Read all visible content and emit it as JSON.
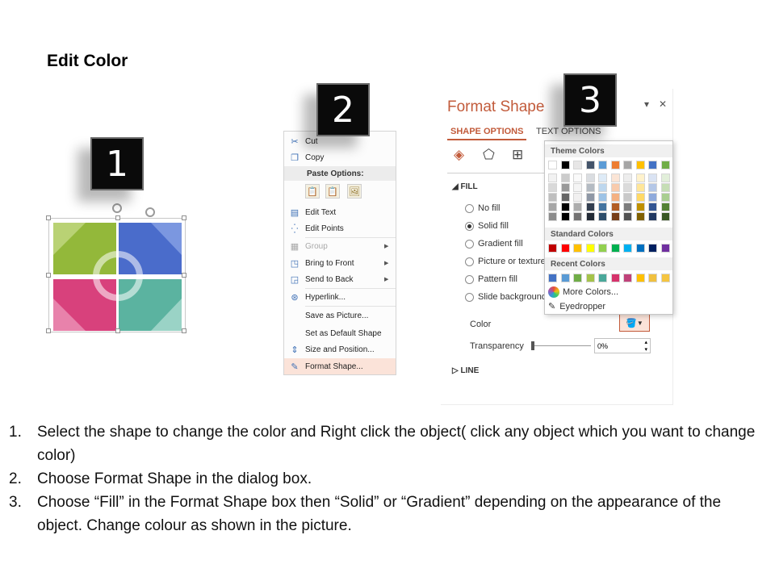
{
  "title": "Edit Color",
  "badges": [
    "1",
    "2",
    "3"
  ],
  "context_menu": {
    "items": [
      {
        "icon": "scissors-icon",
        "glyph": "✂",
        "label": "Cut"
      },
      {
        "icon": "copy-icon",
        "glyph": "❐",
        "label": "Copy"
      }
    ],
    "paste_header": "Paste Options:",
    "items2": [
      {
        "icon": "edit-text-icon",
        "glyph": "▤",
        "label": "Edit Text"
      },
      {
        "icon": "edit-points-icon",
        "glyph": "⁛",
        "label": "Edit Points"
      },
      {
        "icon": "group-icon",
        "glyph": "▦",
        "label": "Group",
        "disabled": true,
        "submenu": true
      },
      {
        "icon": "bring-front-icon",
        "glyph": "◳",
        "label": "Bring to Front",
        "submenu": true
      },
      {
        "icon": "send-back-icon",
        "glyph": "◲",
        "label": "Send to Back",
        "submenu": true
      },
      {
        "icon": "hyperlink-icon",
        "glyph": "⊛",
        "label": "Hyperlink..."
      },
      {
        "icon": "",
        "glyph": "",
        "label": "Save as Picture..."
      },
      {
        "icon": "",
        "glyph": "",
        "label": "Set as Default Shape"
      },
      {
        "icon": "size-position-icon",
        "glyph": "⇕",
        "label": "Size and Position..."
      },
      {
        "icon": "format-shape-icon",
        "glyph": "✎",
        "label": "Format Shape..."
      }
    ]
  },
  "format_pane": {
    "title": "Format Shape",
    "tab_shape": "SHAPE OPTIONS",
    "tab_text": "TEXT OPTIONS",
    "fill_section": "FILL",
    "fill_options": [
      "No fill",
      "Solid fill",
      "Gradient fill",
      "Picture or texture fill",
      "Pattern fill",
      "Slide background fill"
    ],
    "selected_fill": "Solid fill",
    "color_label": "Color",
    "transparency_label": "Transparency",
    "transparency_value": "0%",
    "line_section": "LINE"
  },
  "palette": {
    "theme_header": "Theme Colors",
    "standard_header": "Standard Colors",
    "recent_header": "Recent Colors",
    "more_colors": "More Colors...",
    "eyedropper": "Eyedropper",
    "theme_top": [
      "#ffffff",
      "#000000",
      "#e7e6e6",
      "#44546a",
      "#5b9bd5",
      "#ed7d31",
      "#a5a5a5",
      "#ffc000",
      "#4472c4",
      "#70ad47"
    ],
    "standard": [
      "#c00000",
      "#ff0000",
      "#ffc000",
      "#ffff00",
      "#92d050",
      "#00b050",
      "#00b0f0",
      "#0070c0",
      "#002060",
      "#7030a0"
    ],
    "recent": [
      "#4472c4",
      "#5a9bd5",
      "#70ad47",
      "#a5c34a",
      "#4aa89a",
      "#d6336c",
      "#c0427a",
      "#ffc000",
      "#f0c040",
      "#f5c542"
    ]
  },
  "shape_colors": {
    "green": "#93b83a",
    "blue": "#4a6ccb",
    "pink": "#d8417c",
    "teal": "#5bb3a0"
  },
  "instructions": [
    {
      "num": "1.",
      "text": "Select the shape to change the color and Right click the object( click any object which you want to change color)"
    },
    {
      "num": "2.",
      "text": "Choose Format Shape in the dialog box."
    },
    {
      "num": "3.",
      "text": "Choose “Fill” in the Format Shape box then “Solid” or “Gradient” depending on the appearance of the object. Change colour as shown in the picture."
    }
  ]
}
